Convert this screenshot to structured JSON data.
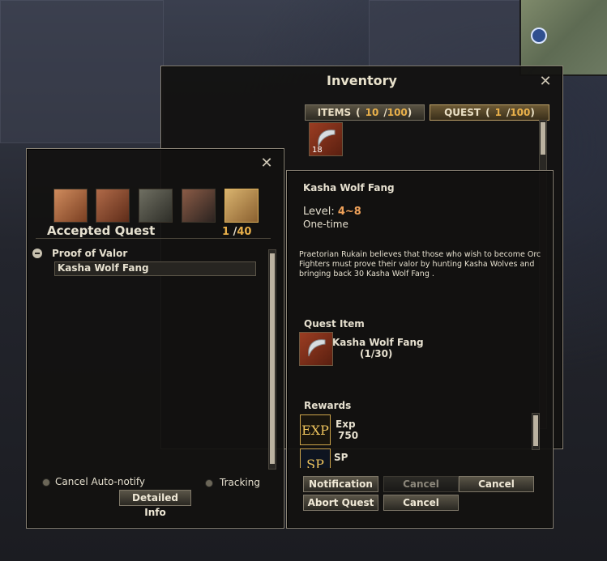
{
  "inventory": {
    "title": "Inventory",
    "tabs": [
      {
        "label": "ITEMS",
        "count": "10",
        "max": "100"
      },
      {
        "label": "QUEST",
        "count": "1",
        "max": "100"
      }
    ],
    "item_stack_count": "18"
  },
  "quest_log": {
    "title": "Accepted Quest",
    "count": "1",
    "max": "40",
    "quest_group": "Proof of Valor",
    "quest_name": "Kasha Wolf Fang",
    "cancel_autonotify_label": "Cancel Auto-notify",
    "tracking_label": "Tracking",
    "detailed_info_label": "Detailed Info"
  },
  "quest_detail": {
    "name": "Kasha Wolf Fang",
    "level_label": "Level:",
    "level_value": "4~8",
    "repeat": "One-time",
    "description": "Praetorian Rukain believes that those who wish to become Orc Fighters must prove their valor by hunting Kasha Wolves and bringing back 30 Kasha Wolf Fang .",
    "quest_item_heading": "Quest Item",
    "quest_item_name": "Kasha Wolf Fang",
    "quest_item_progress": "(1/30)",
    "rewards_heading": "Rewards",
    "rewards": [
      {
        "icon": "EXP",
        "label": "Exp",
        "value": "750"
      },
      {
        "icon": "SP",
        "label": "SP",
        "value": ""
      }
    ],
    "buttons": {
      "notification": "Notification",
      "cancel_disabled": "Cancel",
      "cancel_top": "Cancel",
      "abort": "Abort Quest",
      "cancel_bottom": "Cancel"
    }
  }
}
